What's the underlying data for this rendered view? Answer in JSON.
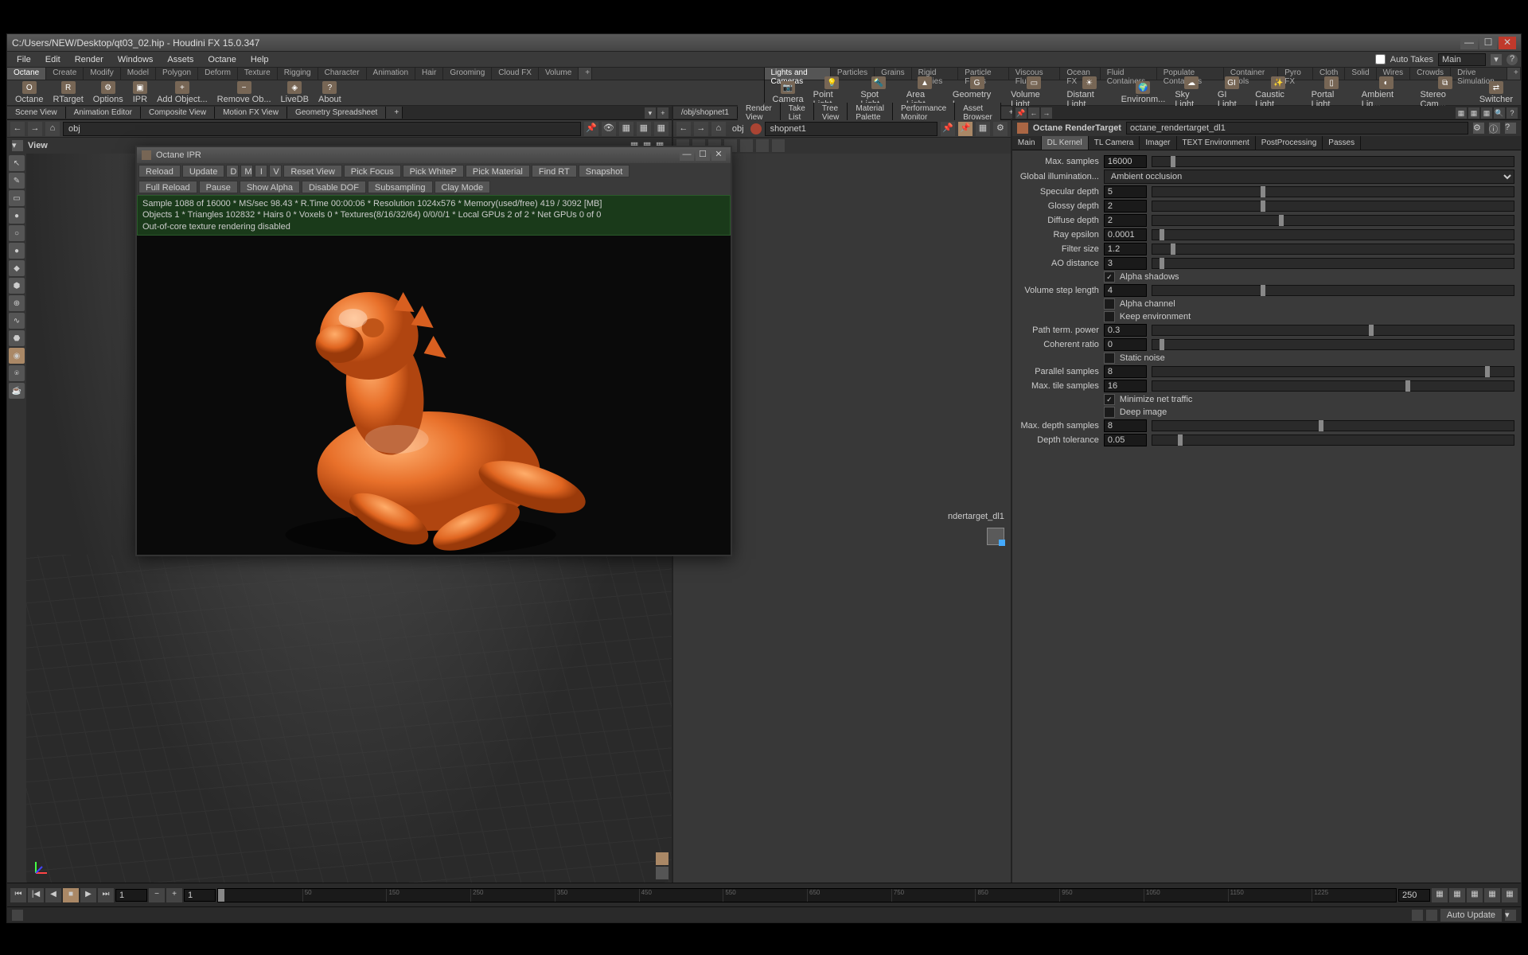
{
  "window": {
    "title": "C:/Users/NEW/Desktop/qt03_02.hip - Houdini FX 15.0.347"
  },
  "menubar": {
    "items": [
      "File",
      "Edit",
      "Render",
      "Windows",
      "Assets",
      "Octane",
      "Help"
    ],
    "auto_takes": "Auto Takes",
    "main": "Main"
  },
  "shelves": {
    "left_tabs": [
      "Octane",
      "Create",
      "Modify",
      "Model",
      "Polygon",
      "Deform",
      "Texture",
      "Rigging",
      "Character",
      "Animation",
      "Hair",
      "Grooming",
      "Cloud FX",
      "Volume"
    ],
    "right_tabs": [
      "Lights and Cameras",
      "Particles",
      "Grains",
      "Rigid Bodies",
      "Particle Fluids",
      "Viscous Fluids",
      "Ocean FX",
      "Fluid Containers",
      "Populate Containers",
      "Container Tools",
      "Pyro FX",
      "Cloth",
      "Solid",
      "Wires",
      "Crowds",
      "Drive Simulation"
    ],
    "left_items": [
      {
        "ico": "O",
        "label": "Octane"
      },
      {
        "ico": "R",
        "label": "RTarget"
      },
      {
        "ico": "⚙",
        "label": "Options"
      },
      {
        "ico": "▣",
        "label": "IPR"
      },
      {
        "ico": "+",
        "label": "Add Object..."
      },
      {
        "ico": "−",
        "label": "Remove Ob..."
      },
      {
        "ico": "◈",
        "label": "LiveDB"
      },
      {
        "ico": "?",
        "label": "About"
      }
    ],
    "right_items": [
      {
        "ico": "📷",
        "label": "Camera"
      },
      {
        "ico": "💡",
        "label": "Point Light"
      },
      {
        "ico": "🔦",
        "label": "Spot Light"
      },
      {
        "ico": "▲",
        "label": "Area Light"
      },
      {
        "ico": "G",
        "label": "Geometry L..."
      },
      {
        "ico": "▭",
        "label": "Volume Light"
      },
      {
        "ico": "☀",
        "label": "Distant Light"
      },
      {
        "ico": "🌍",
        "label": "Environm..."
      },
      {
        "ico": "☁",
        "label": "Sky Light"
      },
      {
        "ico": "GI",
        "label": "GI Light"
      },
      {
        "ico": "✨",
        "label": "Caustic Light"
      },
      {
        "ico": "▯",
        "label": "Portal Light"
      },
      {
        "ico": "◐",
        "label": "Ambient Lig..."
      },
      {
        "ico": "⧉",
        "label": "Stereo Cam..."
      },
      {
        "ico": "⇄",
        "label": "Switcher"
      }
    ]
  },
  "left_pane": {
    "tabs": [
      "Scene View",
      "Animation Editor",
      "Composite View",
      "Motion FX View",
      "Geometry Spreadsheet"
    ],
    "path": "obj",
    "view_label": "View",
    "side_tools": [
      "↖",
      "✎",
      "▭",
      "●",
      "○",
      "●",
      "◆",
      "⬢",
      "⊕",
      "∿",
      "⬣",
      "◉",
      "⍟",
      "☕"
    ]
  },
  "mid_pane": {
    "tabs": [
      "/obj/shopnet1",
      "Render View",
      "Take List",
      "Tree View",
      "Material Palette",
      "Performance Monitor",
      "Asset Browser"
    ],
    "path_prefix": "obj",
    "path": "shopnet1",
    "node_label": "ndertarget_dl1"
  },
  "params": {
    "node_type": "Octane RenderTarget",
    "node_name": "octane_rendertarget_dl1",
    "tabs": [
      "Main",
      "DL Kernel",
      "TL Camera",
      "Imager",
      "TEXT Environment",
      "PostProcessing",
      "Passes"
    ],
    "active_tab": 1,
    "rows": {
      "max_samples": {
        "label": "Max. samples",
        "value": "16000",
        "pos": 5
      },
      "gi": {
        "label": "Global illumination...",
        "value": "Ambient occlusion"
      },
      "specular": {
        "label": "Specular depth",
        "value": "5",
        "pos": 30
      },
      "glossy": {
        "label": "Glossy depth",
        "value": "2",
        "pos": 30
      },
      "diffuse": {
        "label": "Diffuse depth",
        "value": "2",
        "pos": 35
      },
      "ray_eps": {
        "label": "Ray epsilon",
        "value": "0.0001",
        "pos": 2
      },
      "filter": {
        "label": "Filter size",
        "value": "1.2",
        "pos": 5
      },
      "ao_dist": {
        "label": "AO distance",
        "value": "3",
        "pos": 2
      },
      "alpha_shadows": {
        "label": "Alpha shadows",
        "checked": true
      },
      "vol_step": {
        "label": "Volume step length",
        "value": "4",
        "pos": 30
      },
      "alpha_channel": {
        "label": "Alpha channel",
        "checked": false
      },
      "keep_env": {
        "label": "Keep environment",
        "checked": false
      },
      "path_term": {
        "label": "Path term. power",
        "value": "0.3",
        "pos": 60
      },
      "coherent": {
        "label": "Coherent ratio",
        "value": "0",
        "pos": 2
      },
      "static_noise": {
        "label": "Static noise",
        "checked": false
      },
      "parallel": {
        "label": "Parallel samples",
        "value": "8",
        "pos": 92
      },
      "max_tile": {
        "label": "Max. tile samples",
        "value": "16",
        "pos": 70
      },
      "min_net": {
        "label": "Minimize net traffic",
        "checked": true
      },
      "deep_img": {
        "label": "Deep image",
        "checked": false
      },
      "max_depth": {
        "label": "Max. depth samples",
        "value": "8",
        "pos": 46
      },
      "depth_tol": {
        "label": "Depth tolerance",
        "value": "0.05",
        "pos": 7
      }
    }
  },
  "ipr": {
    "title": "Octane IPR",
    "buttons1": [
      "Reload",
      "Update"
    ],
    "toggles": [
      "D",
      "M",
      "I",
      "V"
    ],
    "buttons2": [
      "Reset View",
      "Pick Focus",
      "Pick WhiteP",
      "Pick Material",
      "Find RT",
      "Snapshot"
    ],
    "buttons3": [
      "Full Reload",
      "Pause",
      "Show Alpha",
      "Disable DOF",
      "Subsampling",
      "Clay Mode"
    ],
    "status_lines": [
      "Sample 1088 of 16000 * MS/sec 98.43 * R.Time 00:00:06 * Resolution 1024x576 * Memory(used/free) 419 / 3092 [MB]",
      "Objects 1 * Triangles 102832 * Hairs 0 * Voxels 0 * Textures(8/16/32/64) 0/0/0/1 * Local GPUs 2 of 2 * Net GPUs 0 of 0",
      "Out-of-core texture rendering disabled"
    ]
  },
  "timeline": {
    "start": "1",
    "end": "1",
    "current_end": "250",
    "ticks": [
      "1",
      "50",
      "150",
      "250",
      "350",
      "450",
      "550",
      "650",
      "750",
      "850",
      "950",
      "1050",
      "1150",
      "1225"
    ]
  },
  "statusbar": {
    "auto_update": "Auto Update"
  }
}
